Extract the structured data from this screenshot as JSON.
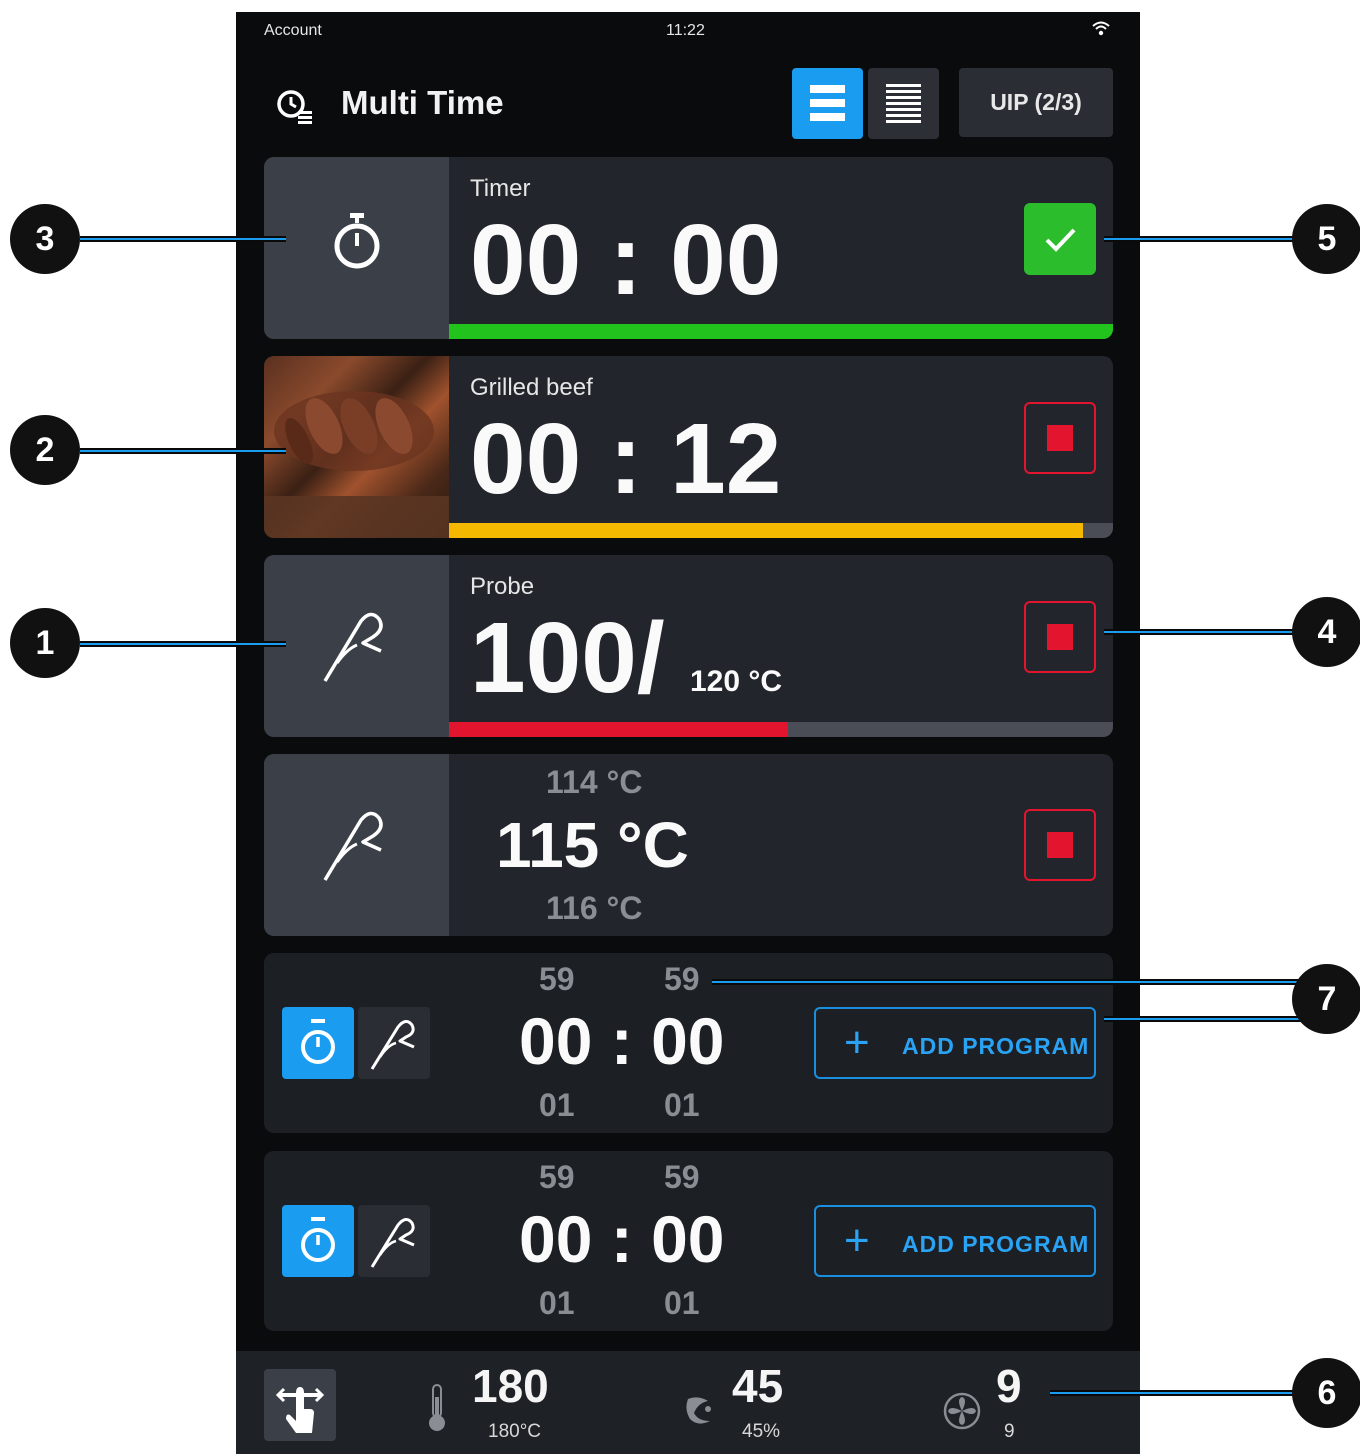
{
  "status_bar": {
    "account": "Account",
    "time": "11:22"
  },
  "header": {
    "title": "Multi Time",
    "uip_label": "UIP (2/3)"
  },
  "cards": {
    "timer": {
      "label": "Timer",
      "value": "00 : 00",
      "progress": 1.0,
      "progress_color": "#22c31c"
    },
    "beef": {
      "label": "Grilled beef",
      "value": "00 : 12",
      "progress": 0.955,
      "progress_color": "#f5b800"
    },
    "probe": {
      "label": "Probe",
      "value": "100/",
      "target": "120 °C",
      "progress": 0.51,
      "progress_color": "#e2142e"
    },
    "probe_select": {
      "above": "114 °C",
      "value": "115 °C",
      "below": "116 °C"
    },
    "new1": {
      "above_min": "59",
      "above_sec": "59",
      "value": "00 : 00",
      "below_min": "01",
      "below_sec": "01",
      "add_label": "ADD PROGRAM"
    },
    "new2": {
      "above_min": "59",
      "above_sec": "59",
      "value": "00 : 00",
      "below_min": "01",
      "below_sec": "01",
      "add_label": "ADD PROGRAM"
    }
  },
  "bottom_bar": {
    "temp_value": "180",
    "temp_sub": "180°C",
    "humidity_value": "45",
    "humidity_sub": "45%",
    "fan_value": "9",
    "fan_sub": "9"
  },
  "callouts": [
    "1",
    "2",
    "3",
    "4",
    "5",
    "6",
    "7"
  ],
  "colors": {
    "accent": "#1a9cf0",
    "stop": "#e2142e",
    "done": "#2bbd2b",
    "card": "#22252b"
  }
}
